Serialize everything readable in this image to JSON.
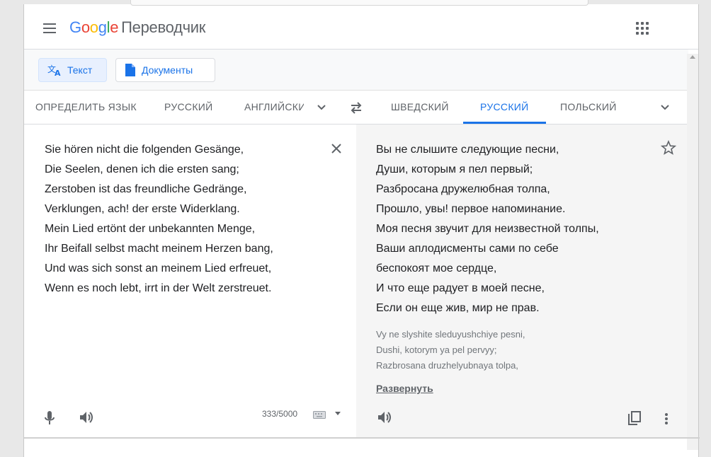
{
  "header": {
    "logo_letters": [
      "G",
      "o",
      "o",
      "g",
      "l",
      "e"
    ],
    "product": "Переводчик"
  },
  "modes": {
    "text_label": "Текст",
    "docs_label": "Документы"
  },
  "source_langs": [
    "ОПРЕДЕЛИТЬ ЯЗЫК",
    "РУССКИЙ",
    "АНГЛИЙСКИЙ"
  ],
  "target_langs": [
    "ШВЕДСКИЙ",
    "РУССКИЙ",
    "ПОЛЬСКИЙ"
  ],
  "source": {
    "lines": [
      "Sie hören nicht die folgenden Gesänge,",
      "Die Seelen, denen ich die ersten sang;",
      "Zerstoben ist das freundliche Gedränge,",
      "Verklungen, ach! der erste Widerklang.",
      "Mein Lied ertönt der unbekannten Menge,",
      "Ihr Beifall selbst macht meinem Herzen bang,",
      "Und was sich sonst an meinem Lied erfreuet,",
      "Wenn es noch lebt, irrt in der Welt zerstreuet."
    ],
    "char_count": "333/5000"
  },
  "target": {
    "lines": [
      "Вы не слышите следующие песни,",
      "Души, которым я пел первый;",
      "Разбросана дружелюбная толпа,",
      "Прошло, увы! первое напоминание.",
      "Моя песня звучит для неизвестной толпы,",
      "Ваши аплодисменты сами по себе",
      "беспокоят мое сердце,",
      "И что еще радует в моей песне,",
      "Если он еще жив, мир не прав."
    ],
    "transliteration": [
      "Vy ne slyshite sleduyushchiye pesni,",
      "Dushi, kotorym ya pel pervyy;",
      "Razbrosana druzhelyubnaya tolpa,"
    ],
    "expand_label": "Развернуть"
  },
  "colors": {
    "accent": "#1a73e8",
    "icon_gray": "#5f6368",
    "target_bg": "#f5f5f5"
  }
}
